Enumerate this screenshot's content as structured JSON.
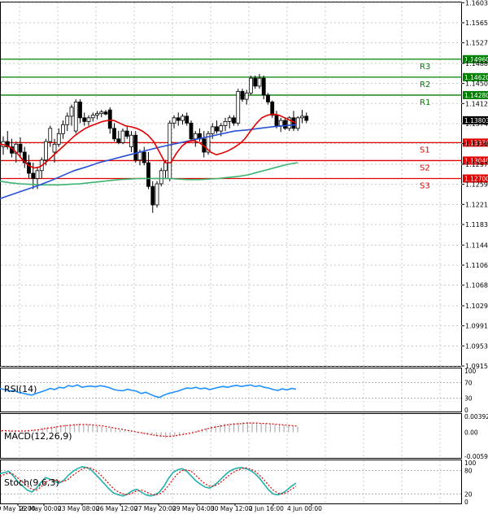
{
  "chart_data": {
    "type": "candlestick",
    "instrument_interval": "H4",
    "main_panel": {
      "ylim": [
        1.0915,
        1.1605
      ],
      "price_ticks": [
        "1.16030",
        "1.15650",
        "1.15270",
        "1.14880",
        "1.14500",
        "1.14120",
        "1.13740",
        "1.13360",
        "1.12970",
        "1.12590",
        "1.12210",
        "1.11830",
        "1.11440",
        "1.11060",
        "1.10680",
        "1.10290",
        "1.09910",
        "1.09530",
        "1.09150"
      ],
      "current_price": {
        "label": "1.13803",
        "value": 1.13803
      },
      "levels": [
        {
          "name": "R3",
          "label": "1.14960",
          "value": 1.1496,
          "color": "#008000"
        },
        {
          "name": "R2",
          "label": "1.14620",
          "value": 1.1462,
          "color": "#008000"
        },
        {
          "name": "R1",
          "label": "1.14280",
          "value": 1.1428,
          "color": "#008000"
        },
        {
          "name": "S1",
          "label": "1.13380",
          "value": 1.1338,
          "color": "#e00000"
        },
        {
          "name": "S2",
          "label": "1.13040",
          "value": 1.1304,
          "color": "#e00000"
        },
        {
          "name": "S3",
          "label": "1.12700",
          "value": 1.127,
          "color": "#e00000"
        }
      ],
      "candles": [
        [
          1.133,
          1.135,
          1.1315,
          1.134
        ],
        [
          1.134,
          1.136,
          1.1325,
          1.133
        ],
        [
          1.133,
          1.1345,
          1.131,
          1.1318
        ],
        [
          1.1318,
          1.134,
          1.13,
          1.1335
        ],
        [
          1.1335,
          1.1348,
          1.131,
          1.132
        ],
        [
          1.132,
          1.133,
          1.129,
          1.13
        ],
        [
          1.13,
          1.1315,
          1.127,
          1.128
        ],
        [
          1.128,
          1.13,
          1.125,
          1.127
        ],
        [
          1.127,
          1.129,
          1.125,
          1.1285
        ],
        [
          1.1285,
          1.131,
          1.127,
          1.1305
        ],
        [
          1.1305,
          1.1345,
          1.1295,
          1.134
        ],
        [
          1.134,
          1.137,
          1.133,
          1.1365
        ],
        [
          1.132,
          1.1345,
          1.13,
          1.1335
        ],
        [
          1.1335,
          1.1365,
          1.133,
          1.1355
        ],
        [
          1.1355,
          1.138,
          1.1345,
          1.1372
        ],
        [
          1.1372,
          1.1395,
          1.136,
          1.1388
        ],
        [
          1.1388,
          1.141,
          1.137,
          1.1405
        ],
        [
          1.136,
          1.142,
          1.1355,
          1.1415
        ],
        [
          1.1415,
          1.142,
          1.1375,
          1.1385
        ],
        [
          1.1385,
          1.1395,
          1.137,
          1.1378
        ],
        [
          1.1378,
          1.139,
          1.137,
          1.1385
        ],
        [
          1.1385,
          1.1395,
          1.1378,
          1.139
        ],
        [
          1.139,
          1.1398,
          1.1382,
          1.1393
        ],
        [
          1.1393,
          1.14,
          1.1386,
          1.1396
        ],
        [
          1.1396,
          1.14,
          1.139,
          1.1392
        ],
        [
          1.14,
          1.1405,
          1.1355,
          1.1365
        ],
        [
          1.1365,
          1.1375,
          1.134,
          1.1345
        ],
        [
          1.1345,
          1.136,
          1.1335,
          1.1338
        ],
        [
          1.1338,
          1.1365,
          1.1335,
          1.136
        ],
        [
          1.136,
          1.137,
          1.1345,
          1.135
        ],
        [
          1.133,
          1.136,
          1.132,
          1.1352
        ],
        [
          1.1352,
          1.136,
          1.13,
          1.1305
        ],
        [
          1.1305,
          1.1325,
          1.1295,
          1.132
        ],
        [
          1.132,
          1.133,
          1.1295,
          1.13
        ],
        [
          1.13,
          1.132,
          1.125,
          1.1255
        ],
        [
          1.1255,
          1.1265,
          1.1205,
          1.122
        ],
        [
          1.122,
          1.1265,
          1.1215,
          1.126
        ],
        [
          1.126,
          1.129,
          1.1255,
          1.1285
        ],
        [
          1.1285,
          1.1305,
          1.127,
          1.13
        ],
        [
          1.127,
          1.138,
          1.1265,
          1.1375
        ],
        [
          1.1375,
          1.139,
          1.1365,
          1.1385
        ],
        [
          1.1385,
          1.1395,
          1.137,
          1.138
        ],
        [
          1.138,
          1.1392,
          1.1372,
          1.1388
        ],
        [
          1.1388,
          1.1395,
          1.137,
          1.1375
        ],
        [
          1.1375,
          1.138,
          1.134,
          1.1345
        ],
        [
          1.1345,
          1.136,
          1.133,
          1.1355
        ],
        [
          1.1355,
          1.1365,
          1.134,
          1.1345
        ],
        [
          1.1345,
          1.136,
          1.131,
          1.132
        ],
        [
          1.132,
          1.136,
          1.1315,
          1.1355
        ],
        [
          1.1355,
          1.1375,
          1.1345,
          1.1368
        ],
        [
          1.1368,
          1.138,
          1.1355,
          1.136
        ],
        [
          1.136,
          1.1375,
          1.135,
          1.137
        ],
        [
          1.137,
          1.1385,
          1.136,
          1.1378
        ],
        [
          1.1378,
          1.139,
          1.1365,
          1.1385
        ],
        [
          1.1385,
          1.139,
          1.137,
          1.1375
        ],
        [
          1.1375,
          1.144,
          1.137,
          1.1435
        ],
        [
          1.1435,
          1.144,
          1.1415,
          1.142
        ],
        [
          1.142,
          1.1438,
          1.141,
          1.1432
        ],
        [
          1.1432,
          1.1465,
          1.1428,
          1.146
        ],
        [
          1.146,
          1.1465,
          1.144,
          1.1445
        ],
        [
          1.1445,
          1.1468,
          1.144,
          1.146
        ],
        [
          1.146,
          1.1465,
          1.142,
          1.1428
        ],
        [
          1.1428,
          1.1432,
          1.141,
          1.1415
        ],
        [
          1.1415,
          1.1418,
          1.1385,
          1.139
        ],
        [
          1.139,
          1.1398,
          1.1365,
          1.137
        ],
        [
          1.137,
          1.1385,
          1.1358,
          1.138
        ],
        [
          1.138,
          1.1385,
          1.1362,
          1.1365
        ],
        [
          1.1365,
          1.1388,
          1.136,
          1.1385
        ],
        [
          1.1385,
          1.1398,
          1.136,
          1.1365
        ],
        [
          1.1365,
          1.1388,
          1.136,
          1.1385
        ],
        [
          1.1385,
          1.14,
          1.1375,
          1.1388
        ],
        [
          1.1388,
          1.1395,
          1.1375,
          1.138
        ]
      ],
      "ma_red": [
        1.1335,
        1.1333,
        1.1328,
        1.1318,
        1.1305,
        1.1295,
        1.129,
        1.1292,
        1.13,
        1.131,
        1.132,
        1.133,
        1.134,
        1.135,
        1.1358,
        1.1365,
        1.137,
        1.1374,
        1.1378,
        1.138,
        1.138,
        1.1375,
        1.137,
        1.1368,
        1.1365,
        1.136,
        1.1352,
        1.134,
        1.132,
        1.13,
        1.13,
        1.1318,
        1.1332,
        1.134,
        1.1342,
        1.1338,
        1.133,
        1.132,
        1.1315,
        1.1318,
        1.1322,
        1.1328,
        1.1335,
        1.1345,
        1.136,
        1.1374,
        1.1385,
        1.139,
        1.1392,
        1.139,
        1.1385,
        1.138,
        1.1375
      ],
      "ma_blue": [
        1.1232,
        1.124,
        1.1248,
        1.1256,
        1.1265,
        1.1275,
        1.1285,
        1.1292,
        1.13,
        1.1306,
        1.1312,
        1.1318,
        1.1324,
        1.133,
        1.1335,
        1.134,
        1.1345,
        1.135,
        1.1355,
        1.136,
        1.1362,
        1.1365,
        1.1368,
        1.137,
        1.1372
      ],
      "ma_green": [
        1.1265,
        1.1262,
        1.126,
        1.1259,
        1.1258,
        1.1258,
        1.1258,
        1.1259,
        1.126,
        1.1262,
        1.1264,
        1.1266,
        1.1268,
        1.1269,
        1.127,
        1.127,
        1.127,
        1.127,
        1.1269,
        1.1268,
        1.1268,
        1.1269,
        1.127,
        1.1272,
        1.1274,
        1.1277,
        1.1282,
        1.1287,
        1.1292,
        1.1297,
        1.13
      ]
    },
    "rsi_panel": {
      "label": "RSI(14)",
      "ticks": [
        "100",
        "70",
        "30",
        "0"
      ],
      "tick_values": [
        100,
        70,
        30,
        0
      ],
      "ylim": [
        0,
        100
      ],
      "values": [
        55,
        52,
        48,
        50,
        45,
        43,
        40,
        38,
        42,
        46,
        50,
        55,
        52,
        58,
        56,
        62,
        60,
        64,
        58,
        60,
        61,
        59,
        62,
        60,
        57,
        52,
        50,
        49,
        53,
        50,
        48,
        42,
        45,
        40,
        35,
        32,
        38,
        42,
        45,
        48,
        52,
        56,
        55,
        58,
        54,
        56,
        52,
        55,
        58,
        60,
        58,
        61,
        63,
        60,
        62,
        64,
        60,
        62,
        58,
        56,
        52,
        50,
        54,
        51,
        55,
        53
      ]
    },
    "macd_panel": {
      "label": "MACD(12,26,9)",
      "ticks": [
        "0.00392",
        "0.00",
        "-0.005934"
      ],
      "tick_values": [
        0.00392,
        0.0,
        -0.005934
      ],
      "ylim": [
        -0.005934,
        0.00392
      ],
      "histogram": [
        0.0005,
        0.0004,
        0.0003,
        0.0002,
        0.0002,
        0.0003,
        0.0004,
        0.0006,
        0.0008,
        0.001,
        0.0012,
        0.0014,
        0.0016,
        0.0018,
        0.0019,
        0.002,
        0.0021,
        0.0021,
        0.002,
        0.0019,
        0.0018,
        0.0016,
        0.0014,
        0.0012,
        0.001,
        0.0008,
        0.0006,
        0.0004,
        0.0002,
        0.0,
        -0.0002,
        -0.0004,
        -0.0006,
        -0.0008,
        -0.001,
        -0.0012,
        -0.0014,
        -0.0012,
        -0.001,
        -0.0007,
        -0.0004,
        -0.0001,
        0.0002,
        0.0005,
        0.0008,
        0.0011,
        0.0014,
        0.0017,
        0.0019,
        0.0021,
        0.0022,
        0.0023,
        0.0024,
        0.0025,
        0.0025,
        0.0024,
        0.0023,
        0.0022,
        0.0021,
        0.002,
        0.0019,
        0.0018,
        0.0017,
        0.0016,
        0.0015,
        0.0014
      ],
      "signal": [
        0.0004,
        0.0004,
        0.0003,
        0.0003,
        0.0003,
        0.0003,
        0.0004,
        0.0005,
        0.0006,
        0.0008,
        0.001,
        0.0011,
        0.0013,
        0.0015,
        0.0016,
        0.0017,
        0.0018,
        0.0019,
        0.0019,
        0.0019,
        0.0018,
        0.0017,
        0.0016,
        0.0014,
        0.0012,
        0.001,
        0.0008,
        0.0006,
        0.0004,
        0.0002,
        0.0,
        -0.0002,
        -0.0004,
        -0.0006,
        -0.0008,
        -0.0009,
        -0.001,
        -0.001,
        -0.0009,
        -0.0007,
        -0.0005,
        -0.0003,
        -0.0001,
        0.0002,
        0.0005,
        0.0008,
        0.0011,
        0.0013,
        0.0015,
        0.0017,
        0.0019,
        0.002,
        0.0021,
        0.0022,
        0.0023,
        0.0023,
        0.0023,
        0.0022,
        0.0022,
        0.0021,
        0.002,
        0.0019,
        0.0018,
        0.0017,
        0.0016,
        0.0015
      ]
    },
    "stoch_panel": {
      "label": "Stoch(9,6,3)",
      "ticks": [
        "100",
        "80",
        "20",
        "0"
      ],
      "tick_values": [
        100,
        80,
        20,
        0
      ],
      "ylim": [
        0,
        100
      ],
      "main": [
        72,
        75,
        78,
        65,
        50,
        40,
        30,
        25,
        35,
        50,
        62,
        58,
        52,
        48,
        55,
        68,
        78,
        85,
        90,
        88,
        82,
        70,
        58,
        45,
        32,
        22,
        18,
        15,
        20,
        28,
        32,
        25,
        18,
        15,
        18,
        25,
        40,
        60,
        75,
        82,
        85,
        78,
        66,
        54,
        45,
        38,
        35,
        42,
        52,
        64,
        75,
        82,
        86,
        88,
        85,
        80,
        72,
        60,
        45,
        30,
        20,
        18,
        22,
        30,
        40,
        48
      ],
      "signal": [
        65,
        70,
        74,
        70,
        60,
        50,
        40,
        32,
        30,
        38,
        50,
        56,
        56,
        52,
        52,
        58,
        68,
        76,
        84,
        88,
        86,
        80,
        70,
        58,
        45,
        33,
        25,
        20,
        18,
        22,
        28,
        30,
        26,
        20,
        17,
        20,
        28,
        42,
        58,
        72,
        80,
        82,
        78,
        68,
        56,
        46,
        40,
        40,
        46,
        55,
        65,
        74,
        80,
        85,
        87,
        84,
        78,
        68,
        56,
        42,
        30,
        22,
        20,
        24,
        32,
        40
      ]
    },
    "x_axis_labels": [
      "19 May 16:00",
      "22 May 00:00",
      "23 May 08:00",
      "26 May 12:00",
      "27 May 20:00",
      "29 May 04:00",
      "30 May 12:00",
      "2 Jun 16:00",
      "4 Jun 00:00"
    ]
  }
}
